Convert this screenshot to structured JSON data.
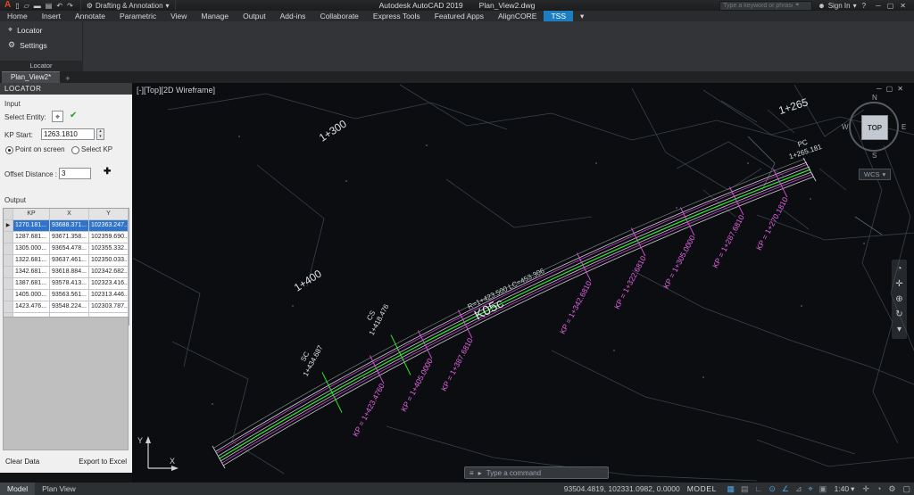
{
  "colors": {
    "accent_blue": "#1c7ec0",
    "selection_blue": "#2f74c9",
    "alignment_green": "#2ee52e",
    "alignment_magenta": "#cc3fcc",
    "kp_label_magenta": "#e866e8",
    "logo_red": "#e8432c",
    "status_active_blue": "#4da6e8"
  },
  "icons": {
    "logo": "A",
    "qat": [
      "▯",
      "▱",
      "▬",
      "▤",
      "↶",
      "↷"
    ],
    "gear": "⚙",
    "caret": "▾",
    "search": "⌖",
    "user": "☻",
    "help": "?",
    "win_min": "─",
    "win_restore": "▢",
    "win_close": "✕",
    "pick": "⌖",
    "check": "✔",
    "spin_up": "▴",
    "spin_down": "▾",
    "plus": "✚",
    "row_marker": "▶",
    "add_tab": "+",
    "locator_tool": "⌖",
    "cmd_customize": "≡",
    "cmd_prompt": "▸",
    "nav": [
      "◔",
      "✛",
      "⊕",
      "↻",
      "▾"
    ],
    "canvas_min": "─",
    "canvas_restore": "▢",
    "canvas_close": "✕"
  },
  "titlebar": {
    "app_title": "Autodesk AutoCAD 2019",
    "file_name": "Plan_View2.dwg",
    "workspace": "Drafting & Annotation",
    "search_placeholder": "Type a keyword or phrase",
    "sign_in": "Sign In"
  },
  "ribbon": {
    "tabs": [
      "Home",
      "Insert",
      "Annotate",
      "Parametric",
      "View",
      "Manage",
      "Output",
      "Add-ins",
      "Collaborate",
      "Express Tools",
      "Featured Apps",
      "AlignCORE",
      "TSS"
    ],
    "panel": {
      "locator": "Locator",
      "settings": "Settings",
      "footer": "Locator"
    }
  },
  "file_tabs": {
    "active": "Plan_View2*"
  },
  "locator": {
    "title": "LOCATOR",
    "input_section": "Input",
    "select_entity_label": "Select Entity:",
    "kp_start_label": "KP Start:",
    "kp_start_value": "1263.1810",
    "radio_point_on_screen": "Point on screen",
    "radio_select_kp": "Select KP",
    "offset_label": "Offset Distance :",
    "offset_value": "3",
    "output_section": "Output",
    "table": {
      "columns": [
        "KP",
        "X",
        "Y"
      ],
      "rows": [
        [
          "1270.181...",
          "93688.371...",
          "102363.247..."
        ],
        [
          "1287.681...",
          "93671.358...",
          "102359.690..."
        ],
        [
          "1305.000...",
          "93654.478...",
          "102355.332..."
        ],
        [
          "1322.681...",
          "93637.461...",
          "102350.033..."
        ],
        [
          "1342.681...",
          "93618.884...",
          "102342.682..."
        ],
        [
          "1387.681...",
          "93578.413...",
          "102323.416..."
        ],
        [
          "1405.000...",
          "93563.561...",
          "102313.446..."
        ],
        [
          "1423.476...",
          "93548.224...",
          "102303.787..."
        ]
      ]
    },
    "clear_button": "Clear Data",
    "export_button": "Export to Excel"
  },
  "canvas": {
    "viewport_label": "[-][Top][2D Wireframe]",
    "viewcube": {
      "n": "N",
      "s": "S",
      "e": "E",
      "w": "W",
      "top": "TOP",
      "wcs": "WCS"
    },
    "labels": {
      "s1265": "1+265",
      "s1300": "1+300",
      "s1400": "1+400",
      "pc": "PC",
      "pc_value": "1+265.181",
      "cs": "CS",
      "cs_value": "1+418.476",
      "sc": "SC",
      "sc_value": "1+434.687",
      "curve_name": "K05c",
      "curve_annotation": "R=1+423.500 LC=453.306",
      "ucs_x": "X",
      "ucs_y": "Y"
    },
    "kp_labels": [
      "KP = 1+270.1810",
      "KP = 1+287.6810",
      "KP = 1+305.0000",
      "KP = 1+322.6810",
      "KP = 1+342.6810",
      "KP = 1+387.6810",
      "KP = 1+405.0000",
      "KP = 1+423.4760"
    ]
  },
  "command_line": {
    "placeholder": "Type a command"
  },
  "status_bar": {
    "layout_tabs": [
      "Model",
      "Plan View"
    ],
    "coords": "93504.4819, 102331.0982, 0.0000",
    "model_badge": "MODEL",
    "scale": "1:40",
    "toggles": [
      "▦",
      "▤",
      "∟",
      "⊙",
      "∠",
      "⊿",
      "⌖",
      "▣"
    ],
    "right_icons": [
      "✛",
      "◔",
      "⚙",
      "▢"
    ]
  }
}
